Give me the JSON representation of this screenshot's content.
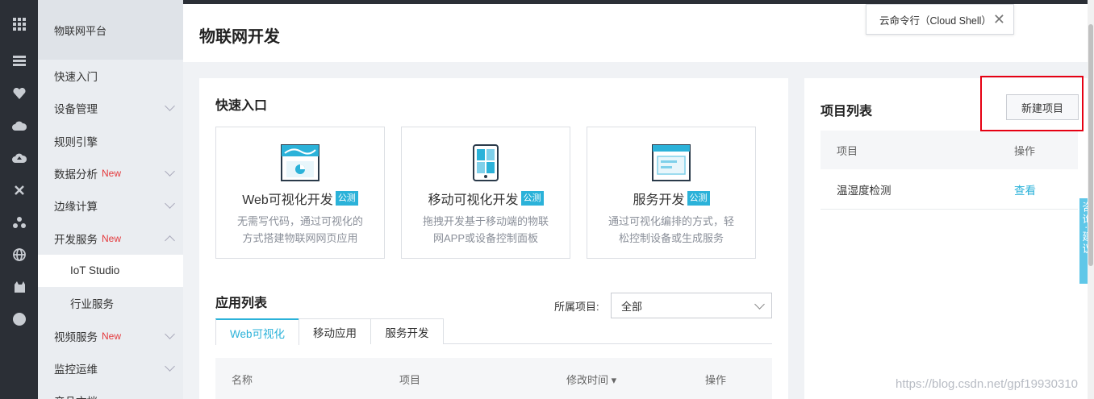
{
  "rail": {
    "icons": [
      "grid-icon",
      "server-icon",
      "heart-icon",
      "cloud-icon",
      "cloud-upload-icon",
      "cross-icon",
      "network-icon",
      "globe-icon",
      "cat-icon",
      "circle-icon"
    ]
  },
  "sidebar": {
    "header": "物联网平台",
    "items": [
      {
        "label": "快速入门",
        "new": "",
        "chevron": ""
      },
      {
        "label": "设备管理",
        "new": "",
        "chevron": "down"
      },
      {
        "label": "规则引擎",
        "new": "",
        "chevron": ""
      },
      {
        "label": "数据分析",
        "new": "New",
        "chevron": "down"
      },
      {
        "label": "边缘计算",
        "new": "",
        "chevron": "down"
      },
      {
        "label": "开发服务",
        "new": "New",
        "chevron": "up"
      },
      {
        "label": "IoT Studio",
        "new": "",
        "chevron": "",
        "sub": true,
        "active": true
      },
      {
        "label": "行业服务",
        "new": "",
        "chevron": "",
        "sub": true
      },
      {
        "label": "视频服务",
        "new": "New",
        "chevron": "down"
      },
      {
        "label": "监控运维",
        "new": "",
        "chevron": "down"
      },
      {
        "label": "产品文档",
        "new": "",
        "chevron": ""
      }
    ]
  },
  "header": {
    "title": "物联网开发"
  },
  "cloud_shell": {
    "label": "云命令行（Cloud Shell）",
    "close": "✕"
  },
  "quick_entry": {
    "title": "快速入口",
    "cards": [
      {
        "title": "Web可视化开发",
        "badge": "公测",
        "desc1": "无需写代码，通过可视化的",
        "desc2": "方式搭建物联网网页应用"
      },
      {
        "title": "移动可视化开发",
        "badge": "公测",
        "desc1": "拖拽开发基于移动端的物联",
        "desc2": "网APP或设备控制面板"
      },
      {
        "title": "服务开发",
        "badge": "公测",
        "desc1": "通过可视化编排的方式，轻",
        "desc2": "松控制设备或生成服务"
      }
    ]
  },
  "app_list": {
    "title": "应用列表",
    "filter_label": "所属项目:",
    "filter_value": "全部",
    "tabs": [
      "Web可视化",
      "移动应用",
      "服务开发"
    ],
    "columns": [
      "名称",
      "项目",
      "修改时间 ▾",
      "操作"
    ]
  },
  "project_list": {
    "title": "项目列表",
    "new_button": "新建项目",
    "columns": [
      "项目",
      "操作"
    ],
    "rows": [
      {
        "name": "温湿度检测",
        "action": "查看"
      }
    ]
  },
  "feedback": {
    "label": "咨询·建议"
  },
  "watermark": "https://blog.csdn.net/gpf19930310",
  "colors": {
    "accent": "#2bb2d9",
    "new_badge": "#e4393c",
    "highlight_box": "#e60012"
  }
}
